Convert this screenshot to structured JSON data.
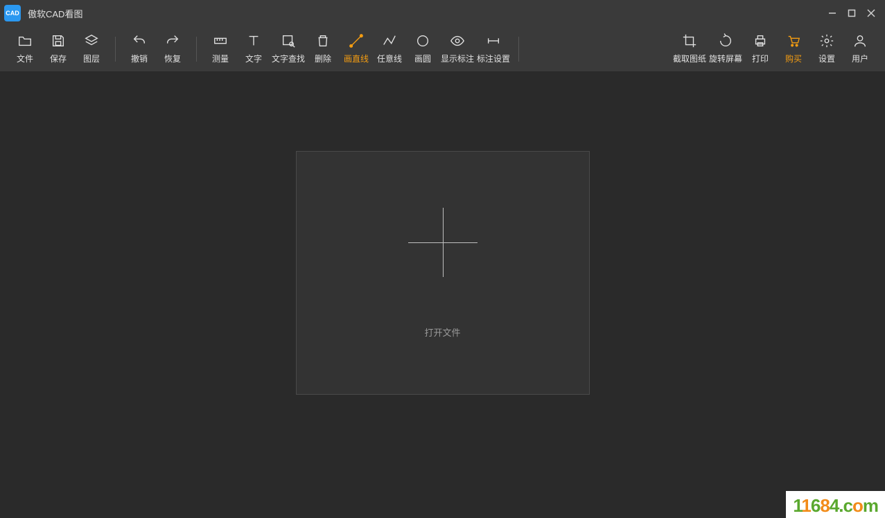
{
  "app": {
    "icon_text": "CAD",
    "title": "傲软CAD看图"
  },
  "toolbar": {
    "file": "文件",
    "save": "保存",
    "layers": "图层",
    "undo": "撤销",
    "redo": "恢复",
    "measure": "测量",
    "text": "文字",
    "find_text": "文字查找",
    "delete": "删除",
    "line": "画直线",
    "polyline": "任意线",
    "circle": "画圆",
    "show_annot": "显示标注",
    "annot_settings": "标注设置",
    "crop": "截取图纸",
    "rotate": "旋转屏幕",
    "print": "打印",
    "buy": "购买",
    "settings": "设置",
    "user": "用户"
  },
  "canvas": {
    "open_file": "打开文件"
  },
  "watermark": {
    "d1": "1",
    "d2": "1",
    "d3": "6",
    "d4": "8",
    "d5": "4",
    "dot": ".",
    "c": "c",
    "o": "o",
    "m": "m"
  }
}
